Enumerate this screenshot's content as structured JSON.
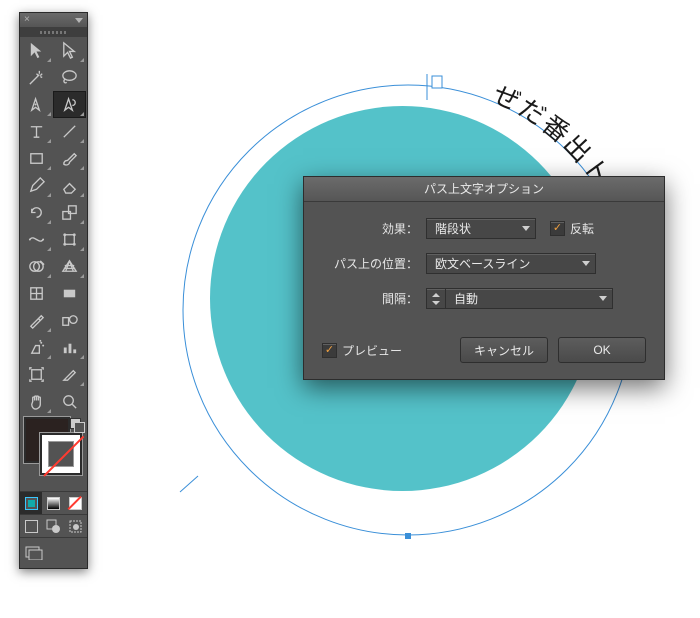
{
  "canvas": {
    "path_text": "ぜだ番出トッセフオのスパ",
    "circle_color": "#54c2c9"
  },
  "tools_panel": {
    "header": {
      "close": "×"
    },
    "tools": [
      {
        "name": "selection-tool",
        "interact": true
      },
      {
        "name": "direct-selection-tool",
        "interact": true
      },
      {
        "name": "magic-wand-tool",
        "interact": true
      },
      {
        "name": "lasso-tool",
        "interact": true
      },
      {
        "name": "pen-tool",
        "interact": true
      },
      {
        "name": "curvature-tool",
        "interact": true,
        "selected": true
      },
      {
        "name": "type-tool",
        "interact": true
      },
      {
        "name": "line-segment-tool",
        "interact": true
      },
      {
        "name": "rectangle-tool",
        "interact": true
      },
      {
        "name": "paintbrush-tool",
        "interact": true
      },
      {
        "name": "pencil-tool",
        "interact": true
      },
      {
        "name": "eraser-tool",
        "interact": true
      },
      {
        "name": "rotate-tool",
        "interact": true
      },
      {
        "name": "scale-tool",
        "interact": true
      },
      {
        "name": "width-tool",
        "interact": true
      },
      {
        "name": "free-transform-tool",
        "interact": true
      },
      {
        "name": "shape-builder-tool",
        "interact": true
      },
      {
        "name": "perspective-grid-tool",
        "interact": true
      },
      {
        "name": "mesh-tool",
        "interact": true
      },
      {
        "name": "gradient-tool",
        "interact": true
      },
      {
        "name": "eyedropper-tool",
        "interact": true
      },
      {
        "name": "blend-tool",
        "interact": true
      },
      {
        "name": "symbol-sprayer-tool",
        "interact": true
      },
      {
        "name": "column-graph-tool",
        "interact": true
      },
      {
        "name": "artboard-tool",
        "interact": true
      },
      {
        "name": "slice-tool",
        "interact": true
      },
      {
        "name": "hand-tool",
        "interact": true
      },
      {
        "name": "zoom-tool",
        "interact": true
      }
    ],
    "fill_color": "#2b2220",
    "stroke_state": "none",
    "color_modes": [
      "color",
      "gradient",
      "none"
    ],
    "draw_modes": [
      "draw-normal",
      "draw-behind",
      "draw-inside"
    ],
    "screen_mode": "change-screen-mode"
  },
  "dialog": {
    "title": "パス上文字オプション",
    "rows": {
      "effect": {
        "label": "効果：",
        "value": "階段状"
      },
      "flip": {
        "label": "反転",
        "checked": true
      },
      "align": {
        "label": "パス上の位置：",
        "value": "欧文ベースライン"
      },
      "spacing": {
        "label": "間隔：",
        "value": "自動"
      }
    },
    "preview": {
      "label": "プレビュー",
      "checked": true
    },
    "buttons": {
      "cancel": "キャンセル",
      "ok": "OK"
    }
  }
}
